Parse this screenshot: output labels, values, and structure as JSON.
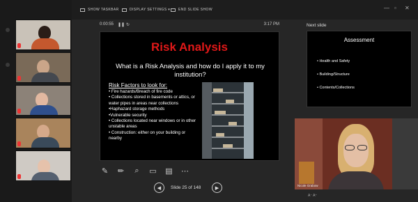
{
  "toolbar": {
    "show_taskbar": "SHOW TASKBAR",
    "display_settings": "DISPLAY SETTINGS ▾",
    "end_show": "END SLIDE SHOW"
  },
  "timer": {
    "elapsed": "0:00:55",
    "clock": "3:17 PM"
  },
  "slide": {
    "title": "Risk Analysis",
    "subtitle": "What is a Risk Analysis and how do I apply it to my institution?",
    "risk_header": "Risk Factors to look for:",
    "items": [
      "• Fire hazards/Breach of fire code",
      "• Collections stored in basements or attics, or water pipes in areas near collections",
      "•Haphazard storage methods",
      "•Vulnerable security",
      "• Collections located near windows or in other unstable areas",
      "• Construction: either on your building or nearby"
    ]
  },
  "navigation": {
    "counter": "Slide 25 of 148",
    "prev": "◀",
    "next": "▶"
  },
  "next_slide": {
    "label": "Next slide",
    "title": "Assessment",
    "items": [
      "• Health and Safety",
      "• Building/Structure",
      "• Contents/Collections"
    ]
  },
  "speaker": {
    "name": "Nicole Grabow"
  },
  "zoom_controls": "A⁻  A⁺",
  "tools": [
    "✎",
    "✏",
    "⌕",
    "▭",
    "▤",
    "⋯"
  ]
}
